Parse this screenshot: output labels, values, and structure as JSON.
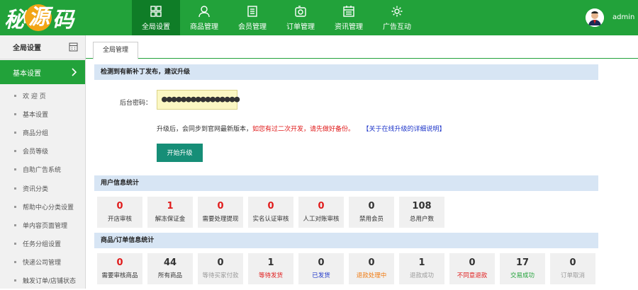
{
  "header": {
    "logo": {
      "part1": "秘",
      "part2": "源",
      "part3": "码"
    },
    "nav": [
      {
        "label": "全局设置",
        "icon": "grid-icon",
        "active": true
      },
      {
        "label": "商品管理",
        "icon": "user-icon"
      },
      {
        "label": "会员管理",
        "icon": "list-icon"
      },
      {
        "label": "订单管理",
        "icon": "camera-icon"
      },
      {
        "label": "资讯管理",
        "icon": "calendar-icon"
      },
      {
        "label": "广告互动",
        "icon": "gear-icon"
      }
    ],
    "username": "admin"
  },
  "sidebar": {
    "title": "全局设置",
    "active_item": "基本设置",
    "items": [
      "欢 迎 页",
      "基本设置",
      "商品分组",
      "会员等级",
      "自助广告系统",
      "资讯分类",
      "帮助中心分类设置",
      "单内容页面管理",
      "任务分组设置",
      "快递公司管理",
      "触发订单/店铺状态"
    ]
  },
  "tab": {
    "label": "全局管理"
  },
  "upgrade": {
    "heading": "检测到有新补丁发布，建议升级",
    "password_label": "后台密码：",
    "password_value": "●●●●●●●●●●●●●●●●",
    "notice_normal": "升级后，会同步到官网最新版本，",
    "notice_red": "如您有过二次开发，请先做好备份。",
    "notice_link": "【关于在线升级的详细说明】",
    "button": "开始升级"
  },
  "user_stats": {
    "heading": "用户信息统计",
    "items": [
      {
        "value": "0",
        "label": "开店审核",
        "color": "#e01b1b"
      },
      {
        "value": "1",
        "label": "解冻保证金",
        "color": "#e01b1b"
      },
      {
        "value": "0",
        "label": "需要处理提现",
        "color": "#e01b1b"
      },
      {
        "value": "0",
        "label": "实名认证审核",
        "color": "#e01b1b"
      },
      {
        "value": "0",
        "label": "人工对账审核",
        "color": "#e01b1b"
      },
      {
        "value": "0",
        "label": "禁用会员",
        "color": "#333333"
      },
      {
        "value": "108",
        "label": "总用户数",
        "color": "#333333"
      }
    ]
  },
  "order_stats": {
    "heading": "商品/订单信息统计",
    "items": [
      {
        "value": "0",
        "label": "需要审核商品",
        "color": "#e01b1b",
        "label_color": "#333333"
      },
      {
        "value": "44",
        "label": "所有商品",
        "color": "#333333",
        "label_color": "#333333"
      },
      {
        "value": "0",
        "label": "等待买家付款",
        "color": "#333333",
        "label_color": "#999999"
      },
      {
        "value": "1",
        "label": "等待发货",
        "color": "#333333",
        "label_color": "#e01b1b"
      },
      {
        "value": "0",
        "label": "已发货",
        "color": "#333333",
        "label_color": "#1d35c9"
      },
      {
        "value": "0",
        "label": "退款处理中",
        "color": "#333333",
        "label_color": "#f07a10"
      },
      {
        "value": "1",
        "label": "退款成功",
        "color": "#333333",
        "label_color": "#999999"
      },
      {
        "value": "0",
        "label": "不同意退款",
        "color": "#333333",
        "label_color": "#e01b1b"
      },
      {
        "value": "17",
        "label": "交易成功",
        "color": "#333333",
        "label_color": "#22a23a"
      },
      {
        "value": "0",
        "label": "订单取消",
        "color": "#333333",
        "label_color": "#999999"
      }
    ]
  }
}
